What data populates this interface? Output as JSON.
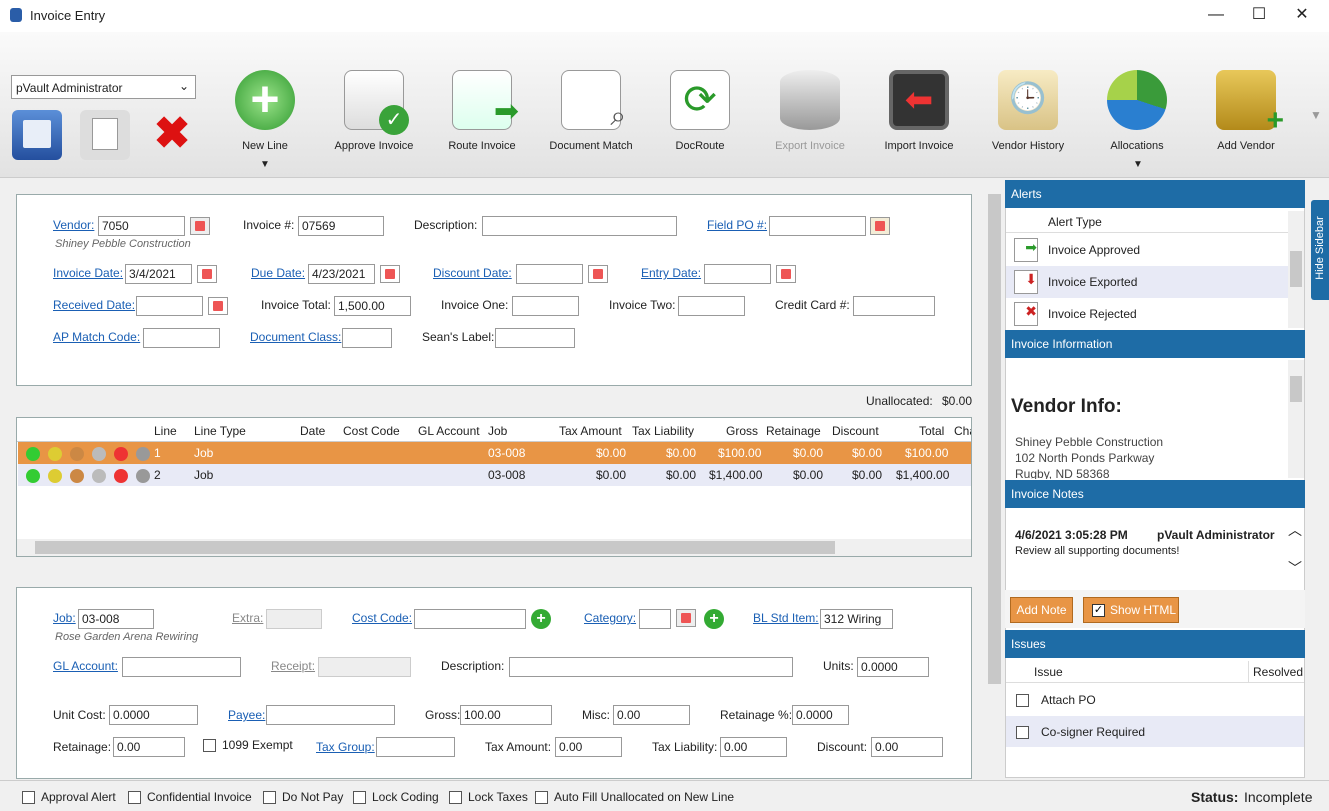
{
  "window": {
    "title": "Invoice Entry",
    "min": "—",
    "max": "☐",
    "close": "✕"
  },
  "ribbon": {
    "user_select": "pVault Administrator",
    "new_line": "New Line",
    "approve": "Approve Invoice",
    "route": "Route Invoice",
    "docmatch": "Document Match",
    "docroute": "DocRoute",
    "export": "Export Invoice",
    "import": "Import Invoice",
    "vendor_history": "Vendor History",
    "allocations": "Allocations",
    "add_vendor": "Add Vendor"
  },
  "header": {
    "vendor_label": "Vendor:",
    "vendor_value": "7050",
    "vendor_name": "Shiney Pebble Construction",
    "invoice_no_label": "Invoice #:",
    "invoice_no_value": "07569",
    "description_label": "Description:",
    "description_value": "",
    "field_po_label": "Field PO #:",
    "field_po_value": "",
    "invoice_date_label": "Invoice Date:",
    "invoice_date_value": "3/4/2021",
    "due_date_label": "Due Date:",
    "due_date_value": "4/23/2021",
    "discount_date_label": "Discount Date:",
    "discount_date_value": "",
    "entry_date_label": "Entry Date:",
    "entry_date_value": "",
    "received_date_label": "Received Date:",
    "received_date_value": "",
    "invoice_total_label": "Invoice Total:",
    "invoice_total_value": "1,500.00",
    "invoice_one_label": "Invoice One:",
    "invoice_one_value": "",
    "invoice_two_label": "Invoice Two:",
    "invoice_two_value": "",
    "credit_card_label": "Credit Card #:",
    "credit_card_value": "",
    "ap_match_label": "AP Match Code:",
    "ap_match_value": "",
    "doc_class_label": "Document Class:",
    "doc_class_value": "",
    "seans_label": "Sean's Label:",
    "seans_value": ""
  },
  "unallocated": {
    "label": "Unallocated:",
    "value": "$0.00"
  },
  "grid": {
    "columns": [
      "Line",
      "Line Type",
      "Date",
      "Cost Code",
      "GL Account",
      "Job",
      "Tax Amount",
      "Tax Liability",
      "Gross",
      "Retainage",
      "Discount",
      "Total",
      "Cha"
    ],
    "rows": [
      {
        "line": "1",
        "type": "Job",
        "date": "",
        "cost_code": "",
        "gl": "",
        "job": "03-008",
        "tax_amount": "$0.00",
        "tax_liability": "$0.00",
        "gross": "$100.00",
        "retainage": "$0.00",
        "discount": "$0.00",
        "total": "$100.00"
      },
      {
        "line": "2",
        "type": "Job",
        "date": "",
        "cost_code": "",
        "gl": "",
        "job": "03-008",
        "tax_amount": "$0.00",
        "tax_liability": "$0.00",
        "gross": "$1,400.00",
        "retainage": "$0.00",
        "discount": "$0.00",
        "total": "$1,400.00"
      }
    ]
  },
  "detail": {
    "job_label": "Job:",
    "job_value": "03-008",
    "job_name": "Rose Garden Arena Rewiring",
    "extra_label": "Extra:",
    "extra_value": "",
    "cost_code_label": "Cost Code:",
    "cost_code_value": "",
    "category_label": "Category:",
    "category_value": "",
    "bl_std_label": "BL Std Item:",
    "bl_std_value": "312 Wiring",
    "gl_label": "GL Account:",
    "gl_value": "",
    "receipt_label": "Receipt:",
    "receipt_value": "",
    "desc_label": "Description:",
    "desc_value": "",
    "units_label": "Units:",
    "units_value": "0.0000",
    "unit_cost_label": "Unit Cost:",
    "unit_cost_value": "0.0000",
    "payee_label": "Payee:",
    "payee_value": "",
    "gross_label": "Gross:",
    "gross_value": "100.00",
    "misc_label": "Misc:",
    "misc_value": "0.00",
    "ret_pct_label": "Retainage %:",
    "ret_pct_value": "0.0000",
    "retainage_label": "Retainage:",
    "retainage_value": "0.00",
    "exempt_label": "1099 Exempt",
    "tax_group_label": "Tax Group:",
    "tax_group_value": "",
    "tax_amount_label": "Tax Amount:",
    "tax_amount_value": "0.00",
    "tax_liab_label": "Tax Liability:",
    "tax_liab_value": "0.00",
    "discount_label": "Discount:",
    "discount_value": "0.00"
  },
  "sidebar": {
    "hide": "Hide Sidebar",
    "alerts_title": "Alerts",
    "alert_type_col": "Alert Type",
    "alerts": [
      "Invoice Approved",
      "Invoice Exported",
      "Invoice Rejected"
    ],
    "info_title": "Invoice Information",
    "vendor_info": "Vendor Info:",
    "vendor_lines": [
      "Shiney Pebble Construction",
      "102 North Ponds Parkway",
      "Rugby, ND 58368"
    ],
    "notes_title": "Invoice Notes",
    "note_date": "4/6/2021 3:05:28 PM",
    "note_user": "pVault Administrator",
    "note_text": "Review all supporting documents!",
    "add_note": "Add Note",
    "show_html": "Show HTML",
    "issues_title": "Issues",
    "issue_col": "Issue",
    "resolved_col": "Resolved",
    "issues": [
      "Attach PO",
      "Co-signer Required"
    ]
  },
  "status": {
    "approval_alert": "Approval Alert",
    "confidential": "Confidential Invoice",
    "do_not_pay": "Do Not Pay",
    "lock_coding": "Lock Coding",
    "lock_taxes": "Lock Taxes",
    "auto_fill": "Auto Fill Unallocated on New Line",
    "status_label": "Status:",
    "status_value": "Incomplete"
  }
}
